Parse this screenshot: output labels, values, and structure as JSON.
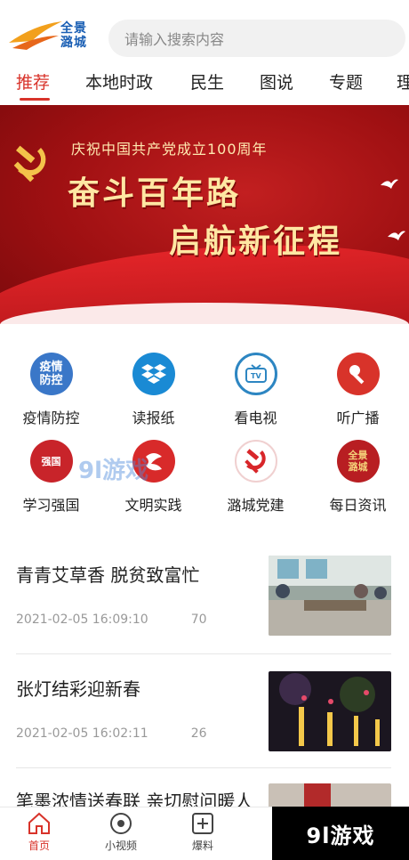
{
  "app": {
    "logo_text_line1": "全景",
    "logo_text_line2": "潞城"
  },
  "search": {
    "placeholder": "请输入搜索内容"
  },
  "tabs": [
    {
      "label": "推荐",
      "active": true
    },
    {
      "label": "本地时政"
    },
    {
      "label": "民生"
    },
    {
      "label": "图说"
    },
    {
      "label": "专题"
    },
    {
      "label": "理"
    }
  ],
  "banner": {
    "subtitle": "庆祝中国共产党成立100周年",
    "line1": "奋斗百年路",
    "line2": "启航新征程"
  },
  "quick_links": [
    {
      "label": "疫情防控",
      "icon": "epidemic-icon",
      "icon_text": "疫情\n防控",
      "color": "#3a77c8"
    },
    {
      "label": "读报纸",
      "icon": "dropbox-icon",
      "color": "#1a8ad4"
    },
    {
      "label": "看电视",
      "icon": "tv-icon",
      "color": "#2d86c2"
    },
    {
      "label": "听广播",
      "icon": "microphone-icon",
      "color": "#d8332a"
    },
    {
      "label": "学习强国",
      "icon": "xuexi-icon",
      "color": "#c8242a"
    },
    {
      "label": "文明实践",
      "icon": "wenming-icon",
      "color": "#d82a2a"
    },
    {
      "label": "潞城党建",
      "icon": "party-emblem-icon",
      "color": "#d8262a"
    },
    {
      "label": "每日资讯",
      "icon": "daily-news-icon",
      "color": "#b81e22"
    }
  ],
  "news": [
    {
      "title": "青青艾草香 脱贫致富忙",
      "time": "2021-02-05 16:09:10",
      "count": "70"
    },
    {
      "title": "张灯结彩迎新春",
      "time": "2021-02-05 16:02:11",
      "count": "26"
    },
    {
      "title": "笔墨浓情送春联 亲切慰问暖人",
      "time": "",
      "count": ""
    }
  ],
  "bottom_nav": [
    {
      "label": "首页",
      "icon": "home-icon",
      "active": true
    },
    {
      "label": "小视频",
      "icon": "video-icon"
    },
    {
      "label": "爆料",
      "icon": "plus-icon"
    }
  ],
  "watermark": {
    "text": "9l游戏",
    "mid_text": "9l游戏"
  },
  "colors": {
    "accent": "#d8332a",
    "banner_red": "#b5161a",
    "gold": "#ffe7a3"
  }
}
